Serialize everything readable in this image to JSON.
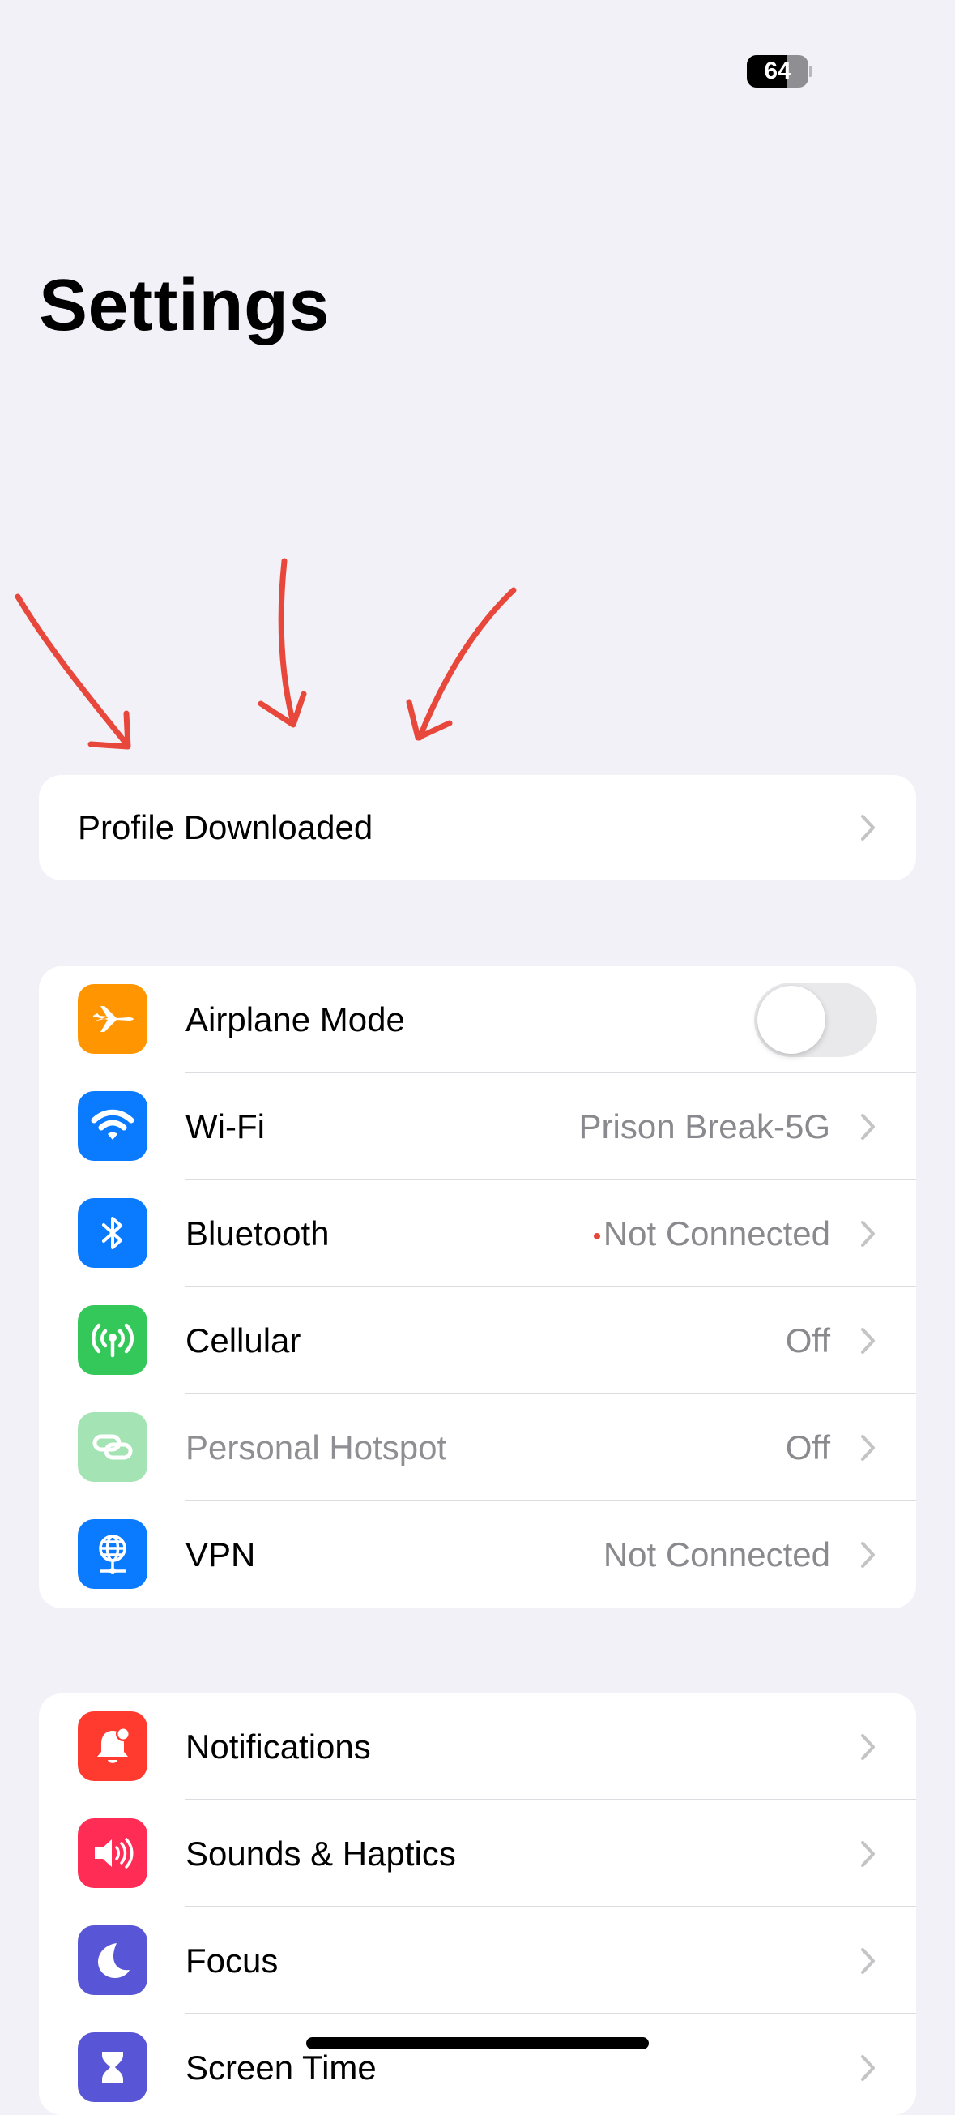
{
  "status_bar": {
    "battery_level": "64",
    "battery_fraction": 0.64
  },
  "header": {
    "title": "Settings"
  },
  "profile": {
    "label": "Profile Downloaded"
  },
  "connectivity": [
    {
      "id": "airplane",
      "label": "Airplane Mode",
      "icon": "airplane-icon",
      "color": "#FF9500",
      "toggle": false
    },
    {
      "id": "wifi",
      "label": "Wi-Fi",
      "value": "Prison Break-5G",
      "icon": "wifi-icon",
      "color": "#0A7AFF"
    },
    {
      "id": "bluetooth",
      "label": "Bluetooth",
      "value": "Not Connected",
      "icon": "bluetooth-icon",
      "color": "#0A7AFF",
      "status_dot": "#E5483B"
    },
    {
      "id": "cellular",
      "label": "Cellular",
      "value": "Off",
      "icon": "antenna-icon",
      "color": "#34C759"
    },
    {
      "id": "hotspot",
      "label": "Personal Hotspot",
      "value": "Off",
      "icon": "link-icon",
      "color": "#A4E3B3",
      "disabled": true
    },
    {
      "id": "vpn",
      "label": "VPN",
      "value": "Not Connected",
      "icon": "globe-icon",
      "color": "#0A7AFF"
    }
  ],
  "notifications_group": [
    {
      "id": "notifications",
      "label": "Notifications",
      "icon": "bell-icon",
      "color": "#FF3B30"
    },
    {
      "id": "sounds",
      "label": "Sounds & Haptics",
      "icon": "speaker-icon",
      "color": "#FF2D55"
    },
    {
      "id": "focus",
      "label": "Focus",
      "icon": "moon-icon",
      "color": "#5856D6"
    },
    {
      "id": "screen-time",
      "label": "Screen Time",
      "icon": "hourglass-icon",
      "color": "#5856D6"
    }
  ],
  "annotation": {
    "color": "#E8473B"
  }
}
